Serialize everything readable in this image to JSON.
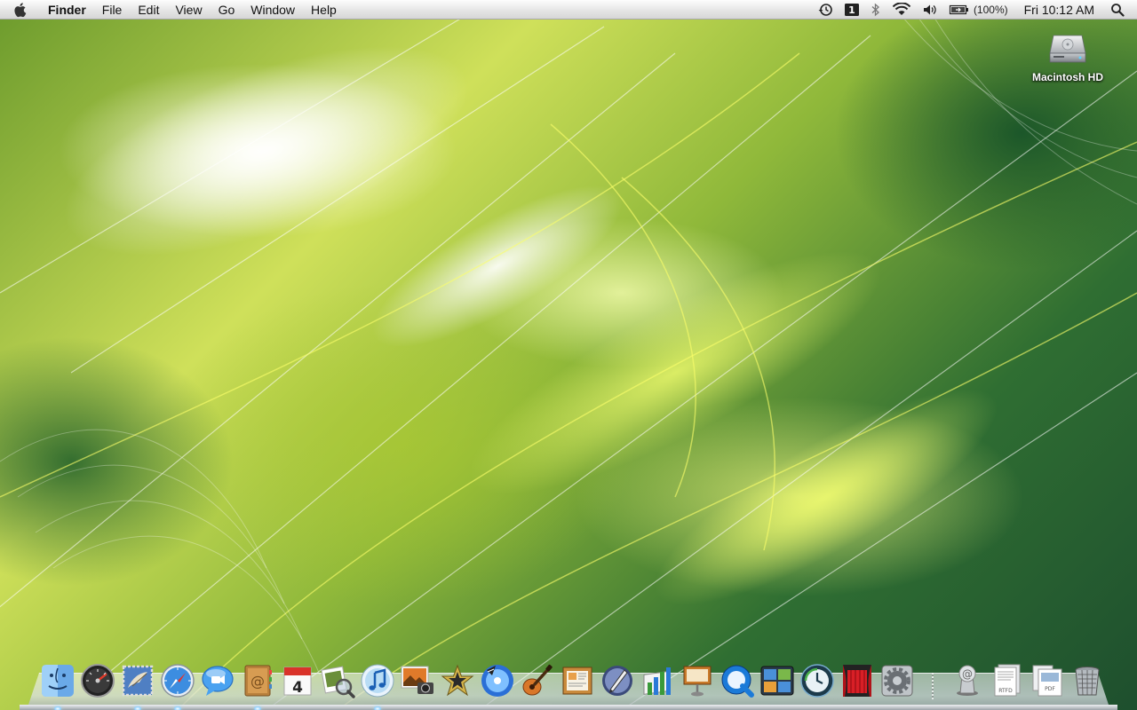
{
  "menubar": {
    "app_name": "Finder",
    "menus": [
      "File",
      "Edit",
      "View",
      "Go",
      "Window",
      "Help"
    ],
    "status_icons": [
      "time-machine-icon",
      "spaces-icon",
      "bluetooth-icon",
      "wifi-icon",
      "volume-icon",
      "battery-icon"
    ],
    "battery_text": "(100%)",
    "clock": "Fri 10:12 AM"
  },
  "desktop": {
    "icons": [
      {
        "label": "Macintosh HD",
        "icon": "hard-drive-icon"
      }
    ]
  },
  "dock": {
    "apps": [
      {
        "name": "Finder",
        "icon": "finder-icon",
        "running": true
      },
      {
        "name": "Dashboard",
        "icon": "dashboard-icon",
        "running": false
      },
      {
        "name": "Mail",
        "icon": "mail-icon",
        "running": true
      },
      {
        "name": "Safari",
        "icon": "safari-icon",
        "running": true
      },
      {
        "name": "iChat",
        "icon": "ichat-icon",
        "running": false
      },
      {
        "name": "Address Book",
        "icon": "address-book-icon",
        "running": true
      },
      {
        "name": "iCal",
        "icon": "ical-icon",
        "running": false,
        "text": "4"
      },
      {
        "name": "Preview",
        "icon": "preview-icon",
        "running": false
      },
      {
        "name": "iTunes",
        "icon": "itunes-icon",
        "running": true
      },
      {
        "name": "iPhoto",
        "icon": "iphoto-icon",
        "running": false
      },
      {
        "name": "iMovie",
        "icon": "imovie-icon",
        "running": false
      },
      {
        "name": "iDVD",
        "icon": "idvd-icon",
        "running": false
      },
      {
        "name": "GarageBand",
        "icon": "garageband-icon",
        "running": false
      },
      {
        "name": "iWeb",
        "icon": "iweb-icon",
        "running": false
      },
      {
        "name": "Pages",
        "icon": "pages-icon",
        "running": false
      },
      {
        "name": "Numbers",
        "icon": "numbers-icon",
        "running": false
      },
      {
        "name": "Keynote",
        "icon": "keynote-icon",
        "running": false
      },
      {
        "name": "QuickTime Player",
        "icon": "quicktime-icon",
        "running": false
      },
      {
        "name": "Spaces",
        "icon": "spaces-app-icon",
        "running": false
      },
      {
        "name": "Time Machine",
        "icon": "time-machine-app-icon",
        "running": false
      },
      {
        "name": "Front Row",
        "icon": "front-row-icon",
        "running": false
      },
      {
        "name": "System Preferences",
        "icon": "system-preferences-icon",
        "running": false
      }
    ],
    "stacks": [
      {
        "name": "Downloads",
        "icon": "downloads-stack-icon"
      },
      {
        "name": "Documents",
        "icon": "documents-stack-icon",
        "text": "RTFD"
      },
      {
        "name": "PDF",
        "icon": "pdf-stack-icon",
        "text": "PDF"
      },
      {
        "name": "Trash",
        "icon": "trash-icon"
      }
    ]
  },
  "colors": {
    "menubar_top": "#fdfdfd",
    "menubar_bottom": "#d6d6d6",
    "wallpaper_light": "#e8f08a",
    "wallpaper_dark": "#1e4f2e",
    "running_indicator": "#8fd0ff"
  }
}
